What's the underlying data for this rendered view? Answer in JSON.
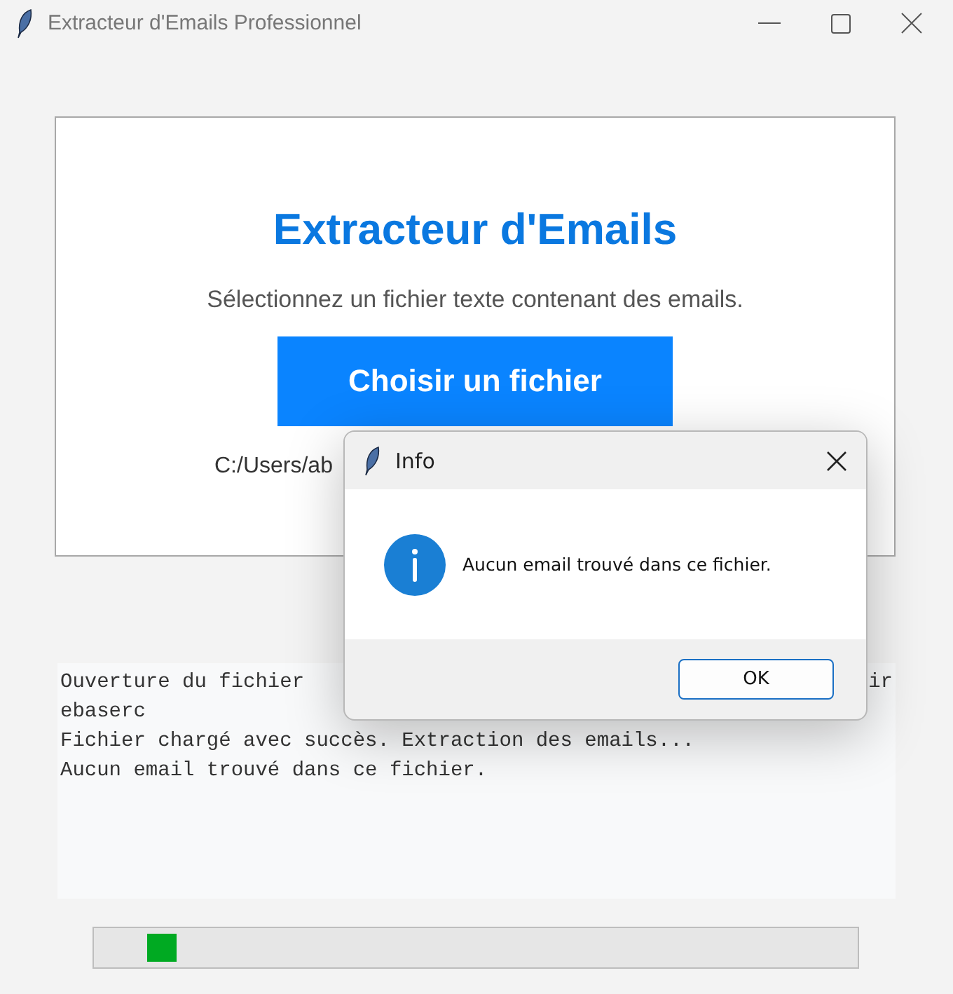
{
  "window": {
    "title": "Extracteur d'Emails Professionnel"
  },
  "card": {
    "heading": "Extracteur d'Emails",
    "subtitle": "Sélectionnez un fichier texte contenant des emails.",
    "button": "Choisir un fichier",
    "path": "C:/Users/ab"
  },
  "log": [
    {
      "left": "Ouverture du fichier",
      "right": "ir"
    },
    {
      "left": "ebaserc"
    },
    {
      "left": "Fichier chargé avec succès. Extraction des emails..."
    },
    {
      "left": "Aucun email trouvé dans ce fichier."
    }
  ],
  "progress": {
    "kind": "indeterminate",
    "level": 0.07
  },
  "dialog": {
    "title": "Info",
    "message": "Aucun email trouvé dans ce fichier.",
    "button": "OK"
  }
}
